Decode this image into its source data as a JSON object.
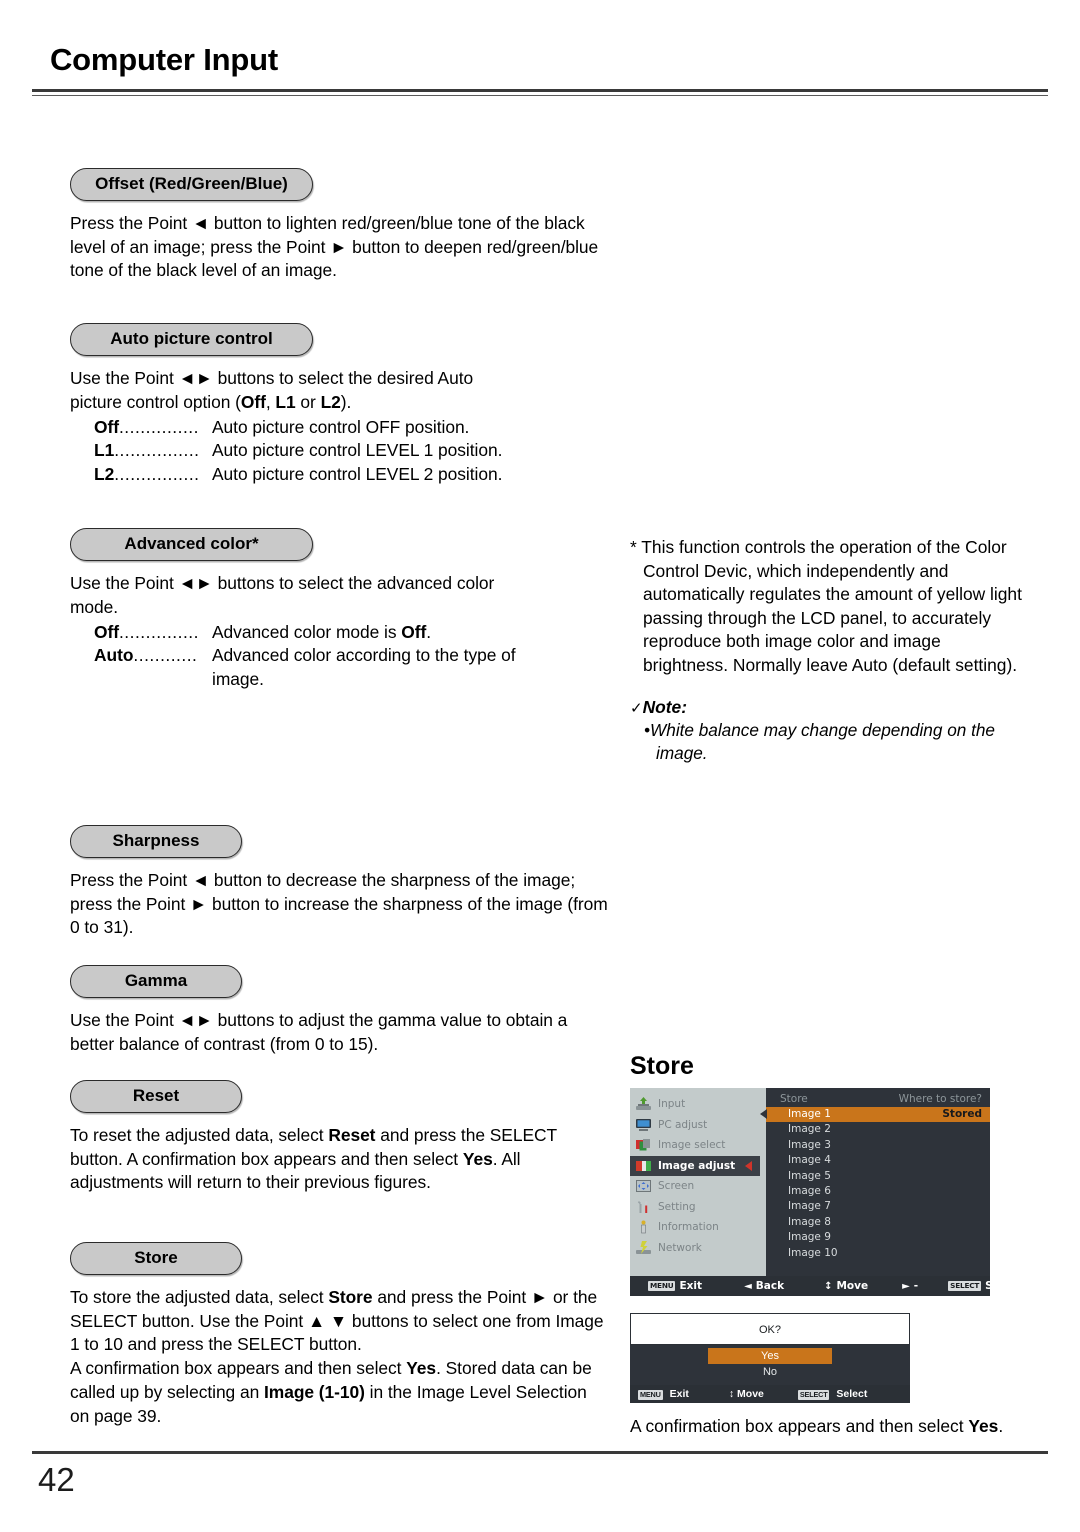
{
  "header": {
    "title": "Computer Input"
  },
  "footer": {
    "page_number": "42"
  },
  "sections": {
    "offset": {
      "heading": "Offset (Red/Green/Blue)",
      "body": "Press the Point ◄ button to lighten red/green/blue tone of the black level of an image; press the Point ► button to deepen red/green/blue tone of the black level of an image."
    },
    "auto_picture_control": {
      "heading": "Auto picture control",
      "intro_1": "Use the Point ◄► buttons to select the desired Auto",
      "intro_2a": "picture control option (",
      "intro_2b": "Off",
      "intro_2c": ", ",
      "intro_2d": "L1",
      "intro_2e": " or ",
      "intro_2f": "L2",
      "intro_2g": ").",
      "options": [
        {
          "term": "Off",
          "dots": "...............",
          "desc": "Auto picture control OFF position."
        },
        {
          "term": "L1",
          "dots": "................",
          "desc": "Auto picture control LEVEL 1 position."
        },
        {
          "term": "L2",
          "dots": "................",
          "desc": "Auto picture control LEVEL 2 position."
        }
      ]
    },
    "advanced_color": {
      "heading": "Advanced color*",
      "intro_1": "Use the Point ◄► buttons to select the advanced color",
      "intro_2": "mode.",
      "options": [
        {
          "term": "Off",
          "dots": "...............",
          "desc_1": "Advanced color mode is ",
          "desc_bold": "Off",
          "desc_2": "."
        },
        {
          "term": "Auto",
          "dots": "............",
          "desc_1": "Advanced color according to the type of",
          "desc_2": "image."
        }
      ]
    },
    "sharpness": {
      "heading": "Sharpness",
      "body": "Press the Point ◄ button to decrease the sharpness of the image; press the Point ► button to increase the sharpness of the image (from 0 to 31)."
    },
    "gamma": {
      "heading": "Gamma",
      "body": "Use the Point ◄► buttons to adjust the gamma value to obtain a better balance of contrast (from 0 to 15)."
    },
    "reset": {
      "heading": "Reset",
      "line_1a": "To reset the adjusted data, select ",
      "line_1b": "Reset",
      "line_1c": " and press the SELECT button. A confirmation box appears and then select ",
      "line_1d": "Yes",
      "line_1e": ". All adjustments will return to their previous figures."
    },
    "store": {
      "heading": "Store",
      "p1a": "To store the adjusted data, select ",
      "p1b": "Store",
      "p1c": " and press the Point ► or the SELECT button. Use the Point ▲ ▼ buttons to select one from Image 1 to 10 and press the SELECT button.",
      "p2a": "A confirmation box appears and then select ",
      "p2b": "Yes",
      "p2c": ". Stored data can be called up by selecting an ",
      "p2d": "Image (1-10)",
      "p2e": " in the Image Level Selection on page 39."
    }
  },
  "footnote": {
    "text": "* This function controls the operation of the Color Control Devic, which independently and automatically regulates the amount of yellow light passing through the LCD panel, to accurately reproduce both image color and image brightness. Normally leave Auto (default setting).",
    "note_check": "✓",
    "note_title": "Note:",
    "note_bullet": "•",
    "note_item": "White balance may change depending on the image."
  },
  "figure": {
    "title": "Store",
    "menu_items": [
      {
        "icon": "input-icon",
        "label": "Input",
        "active": false
      },
      {
        "icon": "pc-adjust-icon",
        "label": "PC adjust",
        "active": false
      },
      {
        "icon": "image-select-icon",
        "label": "Image select",
        "active": false
      },
      {
        "icon": "image-adjust-icon",
        "label": "Image adjust",
        "active": true
      },
      {
        "icon": "screen-icon",
        "label": "Screen",
        "active": false
      },
      {
        "icon": "setting-icon",
        "label": "Setting",
        "active": false
      },
      {
        "icon": "information-icon",
        "label": "Information",
        "active": false
      },
      {
        "icon": "network-icon",
        "label": "Network",
        "active": false
      }
    ],
    "panel_title": "Store",
    "panel_prompt": "Where to store?",
    "panel_rows": [
      {
        "label": "Image 1",
        "right": "Stored",
        "selected": true
      },
      {
        "label": "Image 2",
        "right": "",
        "selected": false
      },
      {
        "label": "Image 3",
        "right": "",
        "selected": false
      },
      {
        "label": "Image 4",
        "right": "",
        "selected": false
      },
      {
        "label": "Image 5",
        "right": "",
        "selected": false
      },
      {
        "label": "Image 6",
        "right": "",
        "selected": false
      },
      {
        "label": "Image 7",
        "right": "",
        "selected": false
      },
      {
        "label": "Image 8",
        "right": "",
        "selected": false
      },
      {
        "label": "Image 9",
        "right": "",
        "selected": false
      },
      {
        "label": "Image 10",
        "right": "",
        "selected": false
      }
    ],
    "status_bar": {
      "exit_key": "MENU",
      "exit_label": "Exit",
      "back_sym": "◄",
      "back_label": "Back",
      "move_sym": "↕",
      "move_label": "Move",
      "adjust_sym": "►",
      "adjust_label": "-----",
      "select_key": "SELECT",
      "select_label": "Select"
    },
    "confirm": {
      "question": "OK?",
      "yes": "Yes",
      "no": "No",
      "bar": {
        "exit_key": "MENU",
        "exit_label": "Exit",
        "move_sym": "↕",
        "move_label": "Move",
        "select_key": "SELECT",
        "select_label": "Select"
      }
    },
    "caption_a": "A confirmation box appears and then select ",
    "caption_b": "Yes",
    "caption_c": "."
  },
  "colors": {
    "pill_fill": "#c9c9c9",
    "osd_sidebar": "#c3cbcb",
    "osd_panel": "#2e333a",
    "osd_highlight": "#c9751b",
    "caret_red": "#d0342a"
  }
}
